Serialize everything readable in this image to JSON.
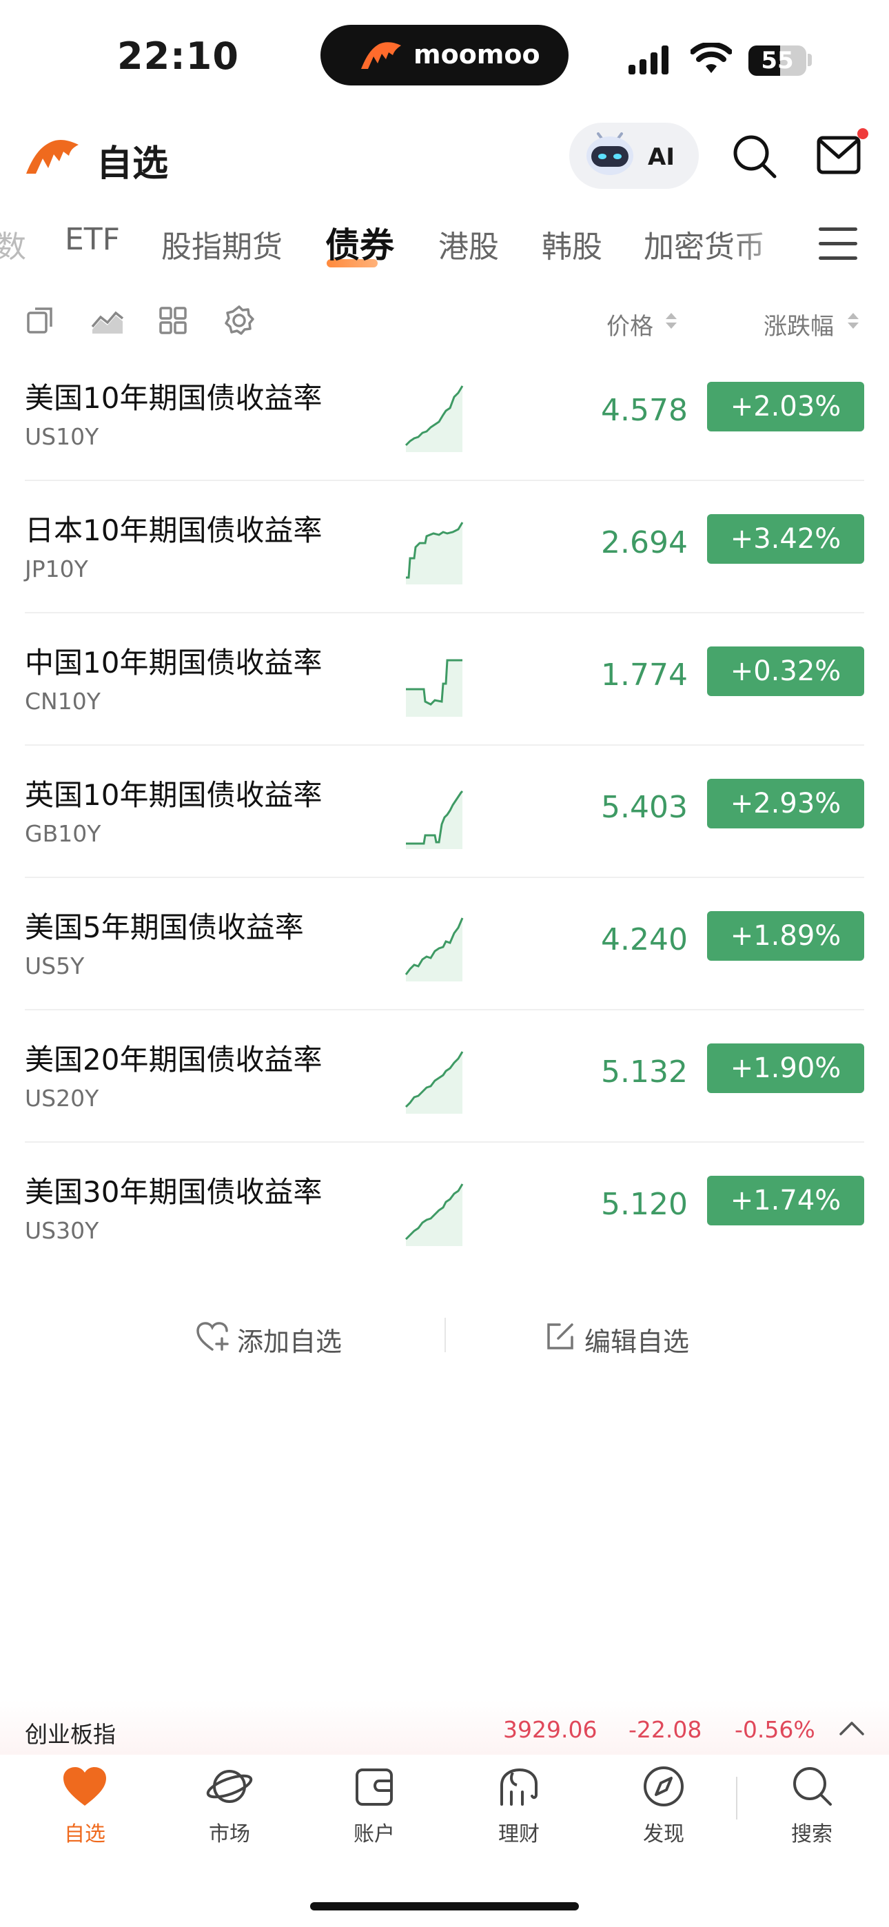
{
  "status_bar": {
    "time": "22:10",
    "battery": "55",
    "island_brand": "moomoo"
  },
  "header": {
    "title": "自选",
    "ai_label": "AI"
  },
  "tabs": [
    {
      "label": "数"
    },
    {
      "label": "ETF"
    },
    {
      "label": "股指期货"
    },
    {
      "label": "债券",
      "active": true
    },
    {
      "label": "港股"
    },
    {
      "label": "韩股"
    },
    {
      "label": "加密货币"
    }
  ],
  "columns": {
    "price": "价格",
    "change": "涨跌幅"
  },
  "rows": [
    {
      "name": "美国10年期国债收益率",
      "code": "US10Y",
      "price": "4.578",
      "change": "+2.03%"
    },
    {
      "name": "日本10年期国债收益率",
      "code": "JP10Y",
      "price": "2.694",
      "change": "+3.42%"
    },
    {
      "name": "中国10年期国债收益率",
      "code": "CN10Y",
      "price": "1.774",
      "change": "+0.32%"
    },
    {
      "name": "英国10年期国债收益率",
      "code": "GB10Y",
      "price": "5.403",
      "change": "+2.93%"
    },
    {
      "name": "美国5年期国债收益率",
      "code": "US5Y",
      "price": "4.240",
      "change": "+1.89%"
    },
    {
      "name": "美国20年期国债收益率",
      "code": "US20Y",
      "price": "5.132",
      "change": "+1.90%"
    },
    {
      "name": "美国30年期国债收益率",
      "code": "US30Y",
      "price": "5.120",
      "change": "+1.74%"
    }
  ],
  "actions": {
    "add": "添加自选",
    "edit": "编辑自选"
  },
  "ticker": {
    "name": "创业板指",
    "price": "3929.06",
    "change": "-22.08",
    "percent": "-0.56%"
  },
  "nav": [
    {
      "label": "自选",
      "icon": "heart-icon",
      "active": true
    },
    {
      "label": "市场",
      "icon": "planet-icon"
    },
    {
      "label": "账户",
      "icon": "wallet-icon"
    },
    {
      "label": "理财",
      "icon": "elephant-icon"
    },
    {
      "label": "发现",
      "icon": "compass-icon"
    },
    {
      "label": "搜索",
      "icon": "search-icon"
    }
  ],
  "colors": {
    "accent": "#ef6a1e",
    "up": "#47a56b",
    "down": "#e0485a"
  }
}
